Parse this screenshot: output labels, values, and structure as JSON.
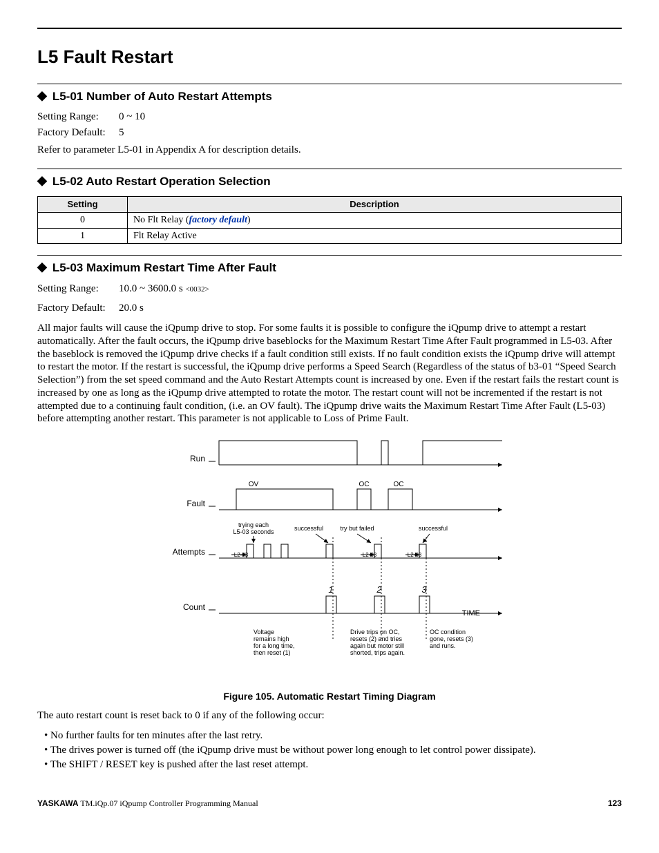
{
  "page": {
    "title": "L5 Fault Restart",
    "footer_brand": "YASKAWA",
    "footer_doc": " TM.iQp.07 iQpump Controller Programming Manual",
    "footer_page": "123"
  },
  "s1": {
    "heading": "L5-01 Number of Auto Restart Attempts",
    "range_label": "Setting Range:",
    "range_value": "0 ~ 10",
    "default_label": "Factory Default:",
    "default_value": "5",
    "refer": "Refer to parameter L5-01 in Appendix A for description details."
  },
  "s2": {
    "heading": "L5-02 Auto Restart Operation Selection",
    "th_setting": "Setting",
    "th_desc": "Description",
    "rows": [
      {
        "setting": "0",
        "desc_pre": "No Flt Relay (",
        "desc_em": "factory default",
        "desc_post": ")"
      },
      {
        "setting": "1",
        "desc_pre": "Flt Relay Active",
        "desc_em": "",
        "desc_post": ""
      }
    ]
  },
  "s3": {
    "heading": "L5-03 Maximum Restart Time After Fault",
    "range_label": "Setting Range:",
    "range_value": "10.0 ~ 3600.0 s ",
    "range_sup": "<0032>",
    "default_label": "Factory Default:",
    "default_value": "20.0 s",
    "para": "All major faults will cause the iQpump drive to stop. For some faults it is possible to configure the iQpump drive to attempt a restart automatically. After the fault occurs, the iQpump drive baseblocks for the Maximum Restart Time After Fault programmed in L5-03. After the baseblock is removed the iQpump drive checks if a fault condition still exists. If no fault condition exists the iQpump drive will attempt to restart the motor. If the restart is successful, the iQpump drive performs a Speed Search (Regardless of the status of b3-01 “Speed Search Selection”) from the set speed command and the Auto Restart Attempts count is increased by one. Even if the restart fails the restart count is increased by one as long as the iQpump drive attempted to rotate the motor. The restart count will not be incremented if the restart is not attempted due to a continuing fault condition, (i.e. an OV fault). The iQpump drive waits the Maximum Restart Time After Fault (L5-03) before attempting another restart. This parameter is not applicable to Loss of Prime Fault."
  },
  "figure": {
    "caption": "Figure 105.  Automatic Restart Timing Diagram",
    "row_run": "Run",
    "row_fault": "Fault",
    "row_attempts": "Attempts",
    "row_count": "Count",
    "time_label": "TIME",
    "ov": "OV",
    "oc1": "OC",
    "oc2": "OC",
    "trying": "trying each\nL5-03 seconds",
    "successful1": "successful",
    "trybutfailed": "try but failed",
    "successful2": "successful",
    "l203a": "L2-03",
    "l203b": "L2-03",
    "l203c": "L2-03",
    "c1": "1",
    "c2": "2",
    "c3": "3",
    "note1": "Voltage\nremains high\nfor a long time,\nthen reset (1)",
    "note2": "Drive trips on OC,\nresets (2) and tries\nagain but motor still\nshorted, trips again.",
    "note3": "OC condition\ngone, resets (3)\nand runs."
  },
  "reset": {
    "intro": "The auto restart count is reset back to 0 if any of the following occur:",
    "items": [
      "No further faults for ten minutes after the last retry.",
      "The drives power is turned off (the iQpump drive must be without power long enough to let control power dissipate).",
      "The SHIFT / RESET key is pushed after the last reset attempt."
    ]
  }
}
